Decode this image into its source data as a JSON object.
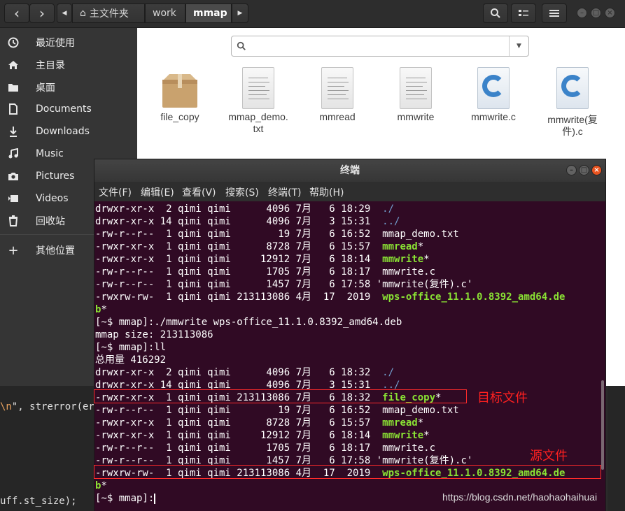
{
  "header": {
    "breadcrumbs": [
      "主文件夹",
      "work",
      "mmap"
    ],
    "back_icon": "‹",
    "forward_icon": "›"
  },
  "sidebar": {
    "items": [
      {
        "label": "最近使用",
        "icon": "clock-icon"
      },
      {
        "label": "主目录",
        "icon": "home-icon"
      },
      {
        "label": "桌面",
        "icon": "folder-icon"
      },
      {
        "label": "Documents",
        "icon": "document-icon"
      },
      {
        "label": "Downloads",
        "icon": "download-icon"
      },
      {
        "label": "Music",
        "icon": "music-icon"
      },
      {
        "label": "Pictures",
        "icon": "camera-icon"
      },
      {
        "label": "Videos",
        "icon": "video-icon"
      },
      {
        "label": "回收站",
        "icon": "trash-icon"
      },
      {
        "label": "其他位置",
        "icon": "plus-icon"
      }
    ]
  },
  "files": [
    {
      "name": "file_copy",
      "type": "package"
    },
    {
      "name": "mmap_demo.\ntxt",
      "type": "text"
    },
    {
      "name": "mmread",
      "type": "text"
    },
    {
      "name": "mmwrite",
      "type": "text"
    },
    {
      "name": "mmwrite.c",
      "type": "c-source"
    },
    {
      "name": "mmwrite(复\n件).c",
      "type": "c-source"
    }
  ],
  "editor": {
    "line1_str": "\\n\", strerror(er",
    "line1_str_prefix": "\\n",
    "line1_rest": "\", strerror(er",
    "line2": "uff.st_size);"
  },
  "terminal": {
    "title": "终端",
    "menu": [
      "文件(F)",
      "编辑(E)",
      "查看(V)",
      "搜索(S)",
      "终端(T)",
      "帮助(H)"
    ],
    "lines": [
      {
        "text": "drwxr-xr-x  2 qimi qimi      4096 7月   6 18:29  ",
        "name": "./",
        "style": "dir"
      },
      {
        "text": "drwxr-xr-x 14 qimi qimi      4096 7月   3 15:31  ",
        "name": "../",
        "style": "dir"
      },
      {
        "text": "-rw-r--r--  1 qimi qimi        19 7月   6 16:52  ",
        "name": "mmap_demo.txt",
        "style": "plain"
      },
      {
        "text": "-rwxr-xr-x  1 qimi qimi      8728 7月   6 15:57  ",
        "name": "mmread",
        "style": "exe",
        "suffix": "*"
      },
      {
        "text": "-rwxr-xr-x  1 qimi qimi     12912 7月   6 18:14  ",
        "name": "mmwrite",
        "style": "exe",
        "suffix": "*"
      },
      {
        "text": "-rw-r--r--  1 qimi qimi      1705 7月   6 18:17  ",
        "name": "mmwrite.c",
        "style": "plain"
      },
      {
        "text": "-rw-r--r--  1 qimi qimi      1457 7月   6 17:58 ",
        "name": "'mmwrite(复件).c'",
        "style": "plain"
      },
      {
        "text": "-rwxrw-rw-  1 qimi qimi 213113086 4月  17  2019  ",
        "name": "wps-office_11.1.0.8392_amd64.de",
        "style": "exe"
      },
      {
        "text": "",
        "name": "b",
        "style": "exe",
        "suffix": "*"
      },
      {
        "text": "[~$ mmap]:./mmwrite wps-office_11.1.0.8392_amd64.deb",
        "name": "",
        "style": "plain"
      },
      {
        "text": "mmap size: 213113086",
        "name": "",
        "style": "plain"
      },
      {
        "text": "[~$ mmap]:ll",
        "name": "",
        "style": "plain"
      },
      {
        "text": "总用量 416292",
        "name": "",
        "style": "plain"
      },
      {
        "text": "drwxr-xr-x  2 qimi qimi      4096 7月   6 18:32  ",
        "name": "./",
        "style": "dir"
      },
      {
        "text": "drwxr-xr-x 14 qimi qimi      4096 7月   3 15:31  ",
        "name": "../",
        "style": "dir"
      },
      {
        "text": "-rwxr-xr-x  1 qimi qimi 213113086 7月   6 18:32  ",
        "name": "file_copy",
        "style": "exe",
        "suffix": "*"
      },
      {
        "text": "-rw-r--r--  1 qimi qimi        19 7月   6 16:52  ",
        "name": "mmap_demo.txt",
        "style": "plain"
      },
      {
        "text": "-rwxr-xr-x  1 qimi qimi      8728 7月   6 15:57  ",
        "name": "mmread",
        "style": "exe",
        "suffix": "*"
      },
      {
        "text": "-rwxr-xr-x  1 qimi qimi     12912 7月   6 18:14  ",
        "name": "mmwrite",
        "style": "exe",
        "suffix": "*"
      },
      {
        "text": "-rw-r--r--  1 qimi qimi      1705 7月   6 18:17  ",
        "name": "mmwrite.c",
        "style": "plain"
      },
      {
        "text": "-rw-r--r--  1 qimi qimi      1457 7月   6 17:58 ",
        "name": "'mmwrite(复件).c'",
        "style": "plain"
      },
      {
        "text": "-rwxrw-rw-  1 qimi qimi 213113086 4月  17  2019  ",
        "name": "wps-office_11.1.0.8392_amd64.de",
        "style": "exe"
      },
      {
        "text": "",
        "name": "b",
        "style": "exe",
        "suffix": "*"
      },
      {
        "text": "[~$ mmap]:",
        "name": "",
        "style": "plain",
        "cursor": true
      }
    ]
  },
  "annotations": {
    "target_label": "目标文件",
    "source_label": "源文件"
  },
  "watermark": "https://blog.csdn.net/haohaohaihuai",
  "colors": {
    "terminal_bg": "#300a24",
    "exe_green": "#8ae234",
    "dir_blue": "#729fcf",
    "highlight_red": "#ff2b2b"
  }
}
